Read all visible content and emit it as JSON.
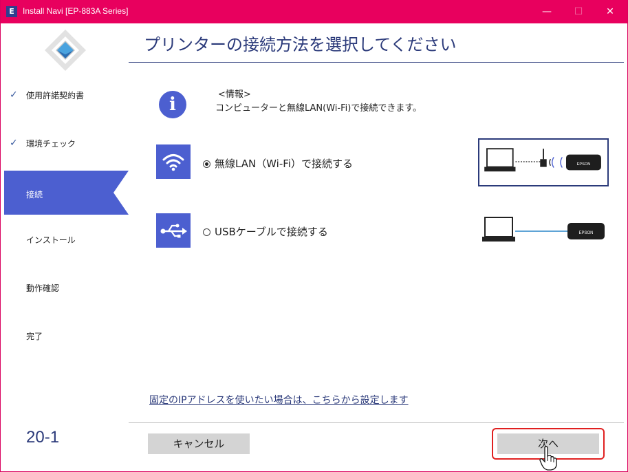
{
  "window": {
    "app_icon": "E",
    "title": "Install Navi [EP-883A Series]",
    "minimize": "—",
    "maximize": "☐",
    "close": "✕"
  },
  "sidebar": {
    "steps": [
      {
        "label": "使用許諾契約書",
        "state": "done"
      },
      {
        "label": "環境チェック",
        "state": "done"
      },
      {
        "label": "接続",
        "state": "active"
      },
      {
        "label": "インストール",
        "state": "pending"
      },
      {
        "label": "動作確認",
        "state": "pending"
      },
      {
        "label": "完了",
        "state": "pending"
      }
    ],
    "check_mark": "✓",
    "page_number": "20-1"
  },
  "main": {
    "title": "プリンターの接続方法を選択してください",
    "info": {
      "heading": "<情報>",
      "body": "コンピューターと無線LAN(Wi-Fi)で接続できます。"
    },
    "options": [
      {
        "label": "無線LAN（Wi-Fi）で接続する",
        "selected": true,
        "icon": "wifi-icon"
      },
      {
        "label": "USBケーブルで接続する",
        "selected": false,
        "icon": "usb-icon"
      }
    ],
    "printer_label": "EPSON",
    "link": "固定のIPアドレスを使いたい場合は、こちらから設定します",
    "cancel_button": "キャンセル",
    "next_button": "次へ"
  },
  "colors": {
    "titlebar": "#e8005e",
    "accent": "#4c5fd0",
    "heading": "#2b3a7a",
    "button": "#d4d4d4",
    "highlight": "#e02020"
  }
}
